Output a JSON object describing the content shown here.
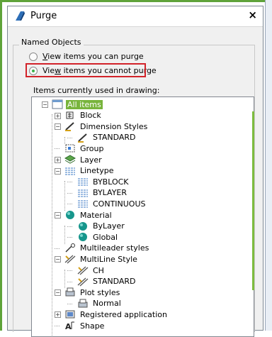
{
  "dialog": {
    "title": "Purge",
    "close_glyph": "×"
  },
  "named_objects": {
    "label": "Named Objects",
    "options": [
      {
        "label_pre": "",
        "key": "V",
        "label_post": "iew items you can purge",
        "selected": false
      },
      {
        "label_pre": "Vie",
        "key": "w",
        "label_post": " items you cannot purge",
        "selected": true
      }
    ]
  },
  "tree": {
    "label": "Items currently used in drawing:",
    "items": [
      {
        "text": "All items",
        "icon": "drawing-icon",
        "expander": "−",
        "level": 0,
        "selected": true
      },
      {
        "text": "Block",
        "icon": "block-icon",
        "expander": "+",
        "level": 1
      },
      {
        "text": "Dimension Styles",
        "icon": "dimension-style-icon",
        "expander": "−",
        "level": 1
      },
      {
        "text": "STANDARD",
        "icon": "dimension-style-icon",
        "expander": "",
        "level": 2
      },
      {
        "text": "Group",
        "icon": "group-icon",
        "expander": "",
        "level": 1
      },
      {
        "text": "Layer",
        "icon": "layer-icon",
        "expander": "+",
        "level": 1
      },
      {
        "text": "Linetype",
        "icon": "linetype-icon",
        "expander": "−",
        "level": 1
      },
      {
        "text": "BYBLOCK",
        "icon": "linetype-icon",
        "expander": "",
        "level": 2
      },
      {
        "text": "BYLAYER",
        "icon": "linetype-icon",
        "expander": "",
        "level": 2
      },
      {
        "text": "CONTINUOUS",
        "icon": "linetype-icon",
        "expander": "",
        "level": 2
      },
      {
        "text": "Material",
        "icon": "material-sphere-icon",
        "expander": "−",
        "level": 1
      },
      {
        "text": "ByLayer",
        "icon": "material-sphere-icon",
        "expander": "",
        "level": 2
      },
      {
        "text": "Global",
        "icon": "material-sphere-icon",
        "expander": "",
        "level": 2
      },
      {
        "text": "Multileader styles",
        "icon": "multileader-icon",
        "expander": "",
        "level": 1
      },
      {
        "text": "MultiLine Style",
        "icon": "multiline-style-icon",
        "expander": "−",
        "level": 1
      },
      {
        "text": "CH",
        "icon": "multiline-style-icon",
        "expander": "",
        "level": 2
      },
      {
        "text": "STANDARD",
        "icon": "multiline-style-icon",
        "expander": "",
        "level": 2
      },
      {
        "text": "Plot styles",
        "icon": "plot-style-icon",
        "expander": "−",
        "level": 1
      },
      {
        "text": "Normal",
        "icon": "plot-style-icon",
        "expander": "",
        "level": 2
      },
      {
        "text": "Registered application",
        "icon": "registered-app-icon",
        "expander": "+",
        "level": 1
      },
      {
        "text": "Shape",
        "icon": "shape-icon",
        "expander": "",
        "level": 1
      }
    ]
  },
  "colors": {
    "accent_green": "#78b43c",
    "highlight_red": "#d2232a",
    "material_teal": "#16968c"
  }
}
